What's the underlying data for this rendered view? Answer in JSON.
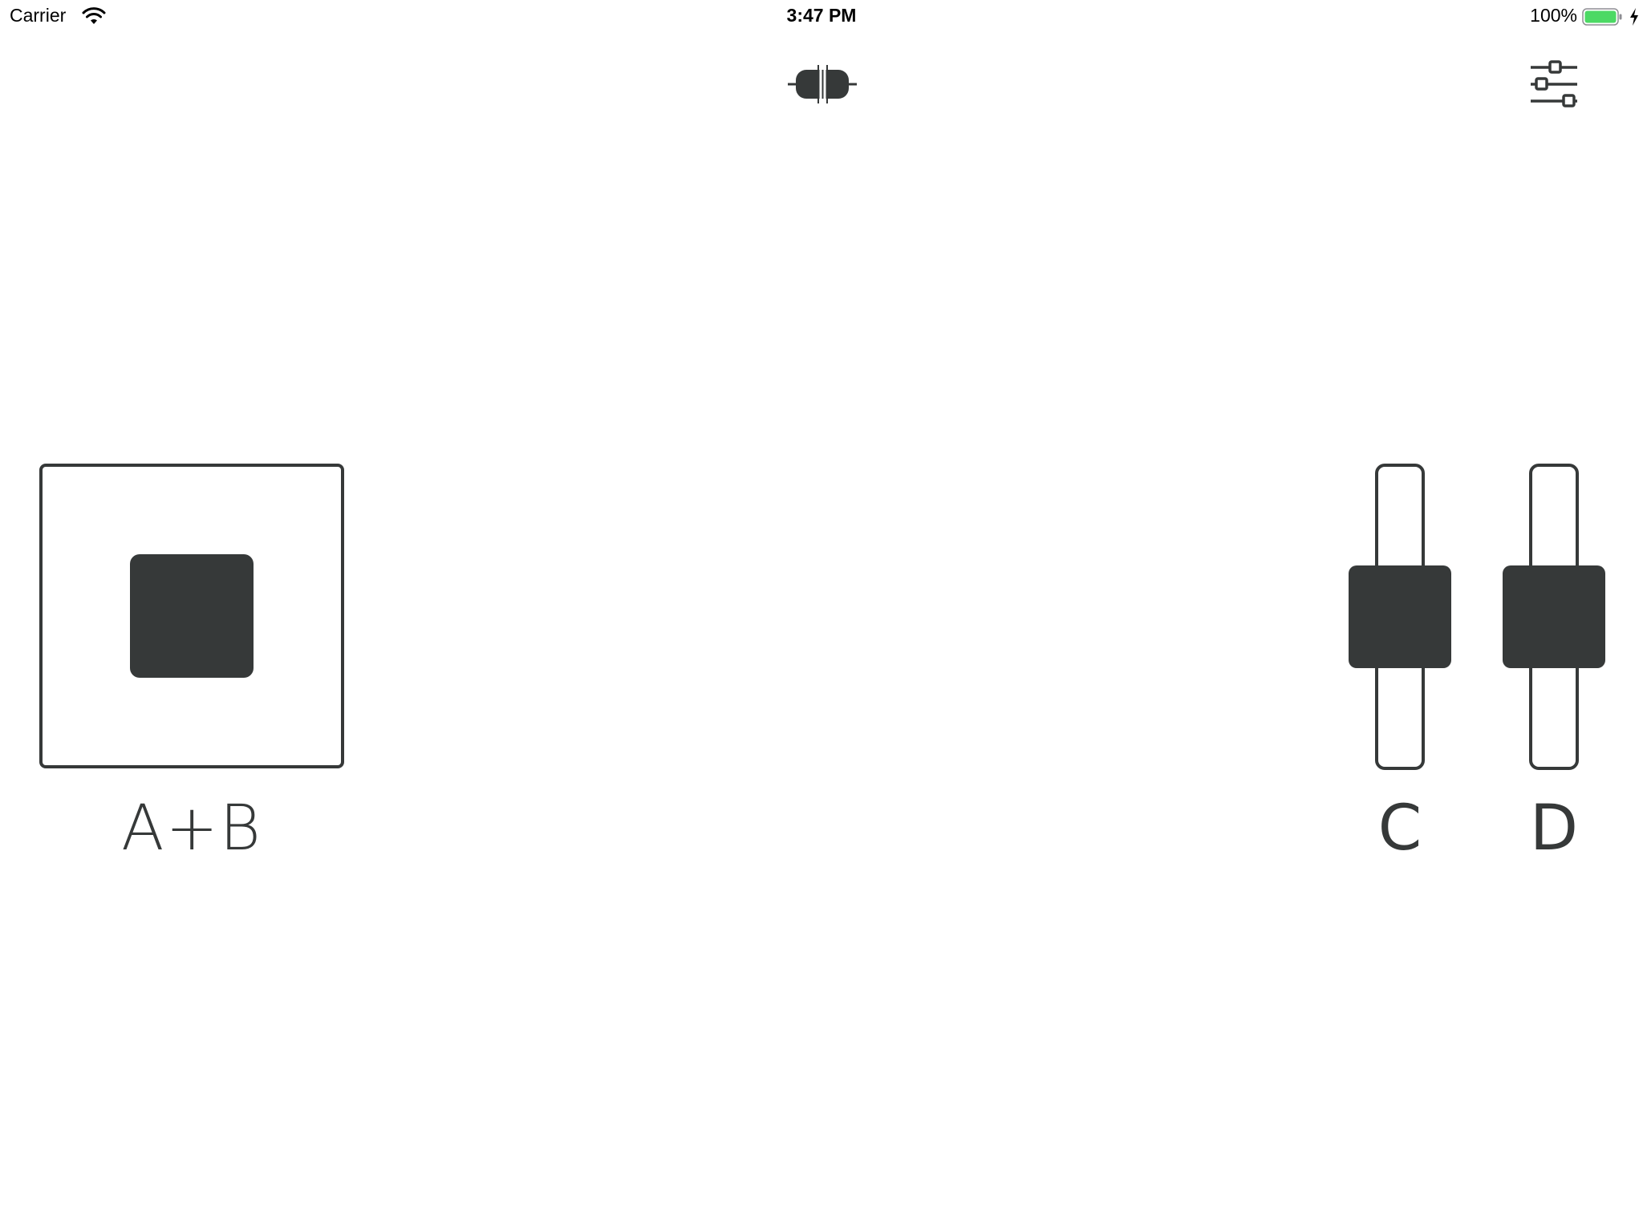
{
  "status_bar": {
    "carrier": "Carrier",
    "time": "3:47 PM",
    "battery_percent": "100%",
    "battery_color": "#4cd964",
    "icons": [
      "wifi-icon",
      "battery-icon",
      "charging-bolt-icon"
    ]
  },
  "toolbar": {
    "connect_icon": "connection-plug-icon",
    "settings_icon": "sliders-settings-icon"
  },
  "controls": {
    "pad": {
      "label": "A+B",
      "x_value": 0.5,
      "y_value": 0.5
    },
    "slider_c": {
      "label": "C",
      "value": 0.5
    },
    "slider_d": {
      "label": "D",
      "value": 0.5
    }
  },
  "colors": {
    "control_dark": "#363939",
    "background": "#ffffff"
  }
}
